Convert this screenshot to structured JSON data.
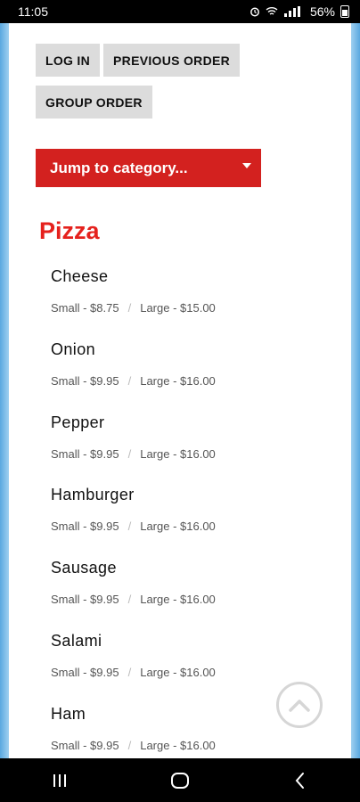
{
  "status": {
    "time": "11:05",
    "battery": "56%"
  },
  "buttons": {
    "login": "LOG IN",
    "previous_order": "PREVIOUS ORDER",
    "group_order": "GROUP ORDER"
  },
  "jump": {
    "label": "Jump to category..."
  },
  "category": {
    "title": "Pizza",
    "items": [
      {
        "name": "Cheese",
        "small": "Small - $8.75",
        "large": "Large - $15.00"
      },
      {
        "name": "Onion",
        "small": "Small - $9.95",
        "large": "Large - $16.00"
      },
      {
        "name": "Pepper",
        "small": "Small - $9.95",
        "large": "Large - $16.00"
      },
      {
        "name": "Hamburger",
        "small": "Small - $9.95",
        "large": "Large - $16.00"
      },
      {
        "name": "Sausage",
        "small": "Small - $9.95",
        "large": "Large - $16.00"
      },
      {
        "name": "Salami",
        "small": "Small - $9.95",
        "large": "Large - $16.00"
      },
      {
        "name": "Ham",
        "small": "Small - $9.95",
        "large": "Large - $16.00"
      }
    ],
    "separator": "/"
  },
  "colors": {
    "accent": "#d3211f",
    "title": "#e5211d",
    "button_bg": "#dcdcdc"
  },
  "icons": {
    "scroll_top": "chevron-up-circle-icon",
    "nav_recent": "recent-apps-icon",
    "nav_home": "home-icon",
    "nav_back": "back-icon"
  }
}
